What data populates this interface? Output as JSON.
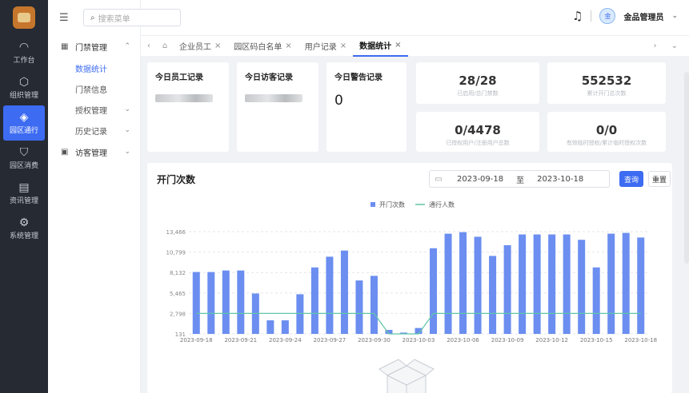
{
  "rail": [
    {
      "label": "工作台",
      "icon": "workbench-icon",
      "glyph": "◠"
    },
    {
      "label": "组织管理",
      "icon": "org-icon",
      "glyph": "⬡"
    },
    {
      "label": "园区通行",
      "icon": "park-access-icon",
      "glyph": "◈",
      "active": true
    },
    {
      "label": "园区消费",
      "icon": "shopping-bag-icon",
      "glyph": "⛉"
    },
    {
      "label": "资讯管理",
      "icon": "news-icon",
      "glyph": "▤"
    },
    {
      "label": "系统管理",
      "icon": "settings-icon",
      "glyph": "⚙"
    }
  ],
  "menu": {
    "group1": "门禁管理",
    "items": [
      "数据统计",
      "门禁信息",
      "授权管理",
      "历史记录"
    ],
    "group2": "访客管理"
  },
  "header": {
    "search_placeholder": "搜索菜单",
    "user": "金品管理员",
    "avatar_text": "金"
  },
  "tabs": [
    {
      "label": "企业员工"
    },
    {
      "label": "园区码白名单"
    },
    {
      "label": "用户记录"
    },
    {
      "label": "数据统计",
      "active": true
    }
  ],
  "cards": {
    "staff_title": "今日员工记录",
    "visitor_title": "今日访客记录",
    "alarm_title": "今日警告记录",
    "alarm_value": "0"
  },
  "stats": [
    {
      "value": "28/28",
      "label": "已启用/总门禁数"
    },
    {
      "value": "552532",
      "label": "累计开门总次数"
    },
    {
      "value": "0/4478",
      "label": "已授权用户/注册用户总数"
    },
    {
      "value": "0/0",
      "label": "有效临时授权/累计临时授权次数"
    }
  ],
  "panel": {
    "title": "开门次数",
    "date_from": "2023-09-18",
    "date_sep": "至",
    "date_to": "2023-10-18",
    "query": "查询",
    "reset": "重置"
  },
  "chart_data": {
    "type": "bar",
    "legend": [
      "开门次数",
      "通行人数"
    ],
    "x": [
      "2023-09-18",
      "2023-09-19",
      "2023-09-20",
      "2023-09-21",
      "2023-09-22",
      "2023-09-23",
      "2023-09-24",
      "2023-09-25",
      "2023-09-26",
      "2023-09-27",
      "2023-09-28",
      "2023-09-29",
      "2023-09-30",
      "2023-10-01",
      "2023-10-02",
      "2023-10-03",
      "2023-10-04",
      "2023-10-05",
      "2023-10-06",
      "2023-10-07",
      "2023-10-08",
      "2023-10-09",
      "2023-10-10",
      "2023-10-11",
      "2023-10-12",
      "2023-10-13",
      "2023-10-14",
      "2023-10-15",
      "2023-10-16",
      "2023-10-17",
      "2023-10-18"
    ],
    "x_tick_labels": [
      "2023-09-18",
      "2023-09-21",
      "2023-09-24",
      "2023-09-27",
      "2023-09-30",
      "2023-10-03",
      "2023-10-06",
      "2023-10-09",
      "2023-10-12",
      "2023-10-15",
      "2023-10-18"
    ],
    "yticks": [
      131,
      2798,
      5465,
      8132,
      10799,
      13466
    ],
    "ylim": [
      131,
      13466
    ],
    "series": [
      {
        "name": "开门次数",
        "type": "bar",
        "color": "#6b8ef0",
        "values": [
          8200,
          8200,
          8400,
          8400,
          5400,
          1900,
          1900,
          5300,
          8800,
          10200,
          11000,
          7100,
          7700,
          650,
          300,
          900,
          11300,
          13200,
          13400,
          12800,
          10300,
          11700,
          13100,
          13100,
          13100,
          13100,
          12400,
          8800,
          13200,
          13300,
          12700
        ]
      },
      {
        "name": "通行人数",
        "type": "line",
        "color": "#5fc6a7",
        "values": [
          2800,
          2800,
          2800,
          2800,
          2800,
          2800,
          2800,
          2800,
          2800,
          2800,
          2800,
          2800,
          2800,
          131,
          131,
          131,
          2800,
          2800,
          2800,
          2800,
          2800,
          2800,
          2800,
          2800,
          2800,
          2800,
          2800,
          2800,
          2800,
          2800,
          2800
        ]
      }
    ]
  }
}
